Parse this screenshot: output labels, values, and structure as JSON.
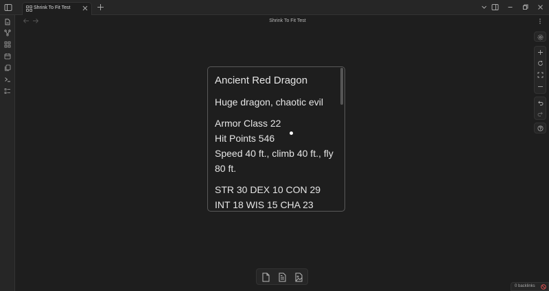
{
  "tab": {
    "title": "Shrink To Fit Test"
  },
  "view": {
    "title": "Shrink To Fit Test"
  },
  "card": {
    "heading": "Ancient Red Dragon",
    "line_type": "Huge dragon, chaotic evil",
    "line_ac": "Armor Class 22",
    "line_hp": "Hit Points 546",
    "line_speed": "Speed 40 ft., climb 40 ft., fly 80 ft.",
    "line_stats": "STR 30 DEX 10 CON 29 INT 18 WIS 15 CHA 23"
  },
  "status": {
    "backlinks": "0 backlinks"
  },
  "colors": {
    "accent": "#e05252",
    "background": "#1e1e1e"
  }
}
